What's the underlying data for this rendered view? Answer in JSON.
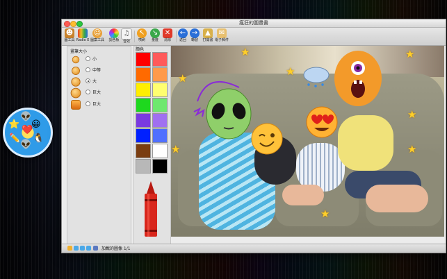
{
  "window": {
    "title": "瘋狂的圖畫書"
  },
  "toolbar": {
    "buttons": [
      {
        "label": "圖工具",
        "icon": "person-tool-icon",
        "color": "#c9822b"
      },
      {
        "label": "Radio E",
        "icon": "crayons-icon",
        "color": "#3a8d3a"
      },
      {
        "label": "圖案工具",
        "icon": "smiley-icon",
        "color": "#e8a13a"
      },
      {
        "label": "調色板",
        "icon": "palette-icon",
        "color": "#8a5ad8"
      },
      {
        "label": "音效",
        "icon": "music-icon",
        "color": "#777777"
      },
      {
        "label": "噴刷",
        "icon": "spray-icon",
        "color": "#f0a020"
      },
      {
        "label": "量度",
        "icon": "check-icon",
        "color": "#3aa84a"
      },
      {
        "label": "清除",
        "icon": "close-icon",
        "color": "#e03a2a"
      },
      {
        "label": "返回",
        "icon": "back-arrow-icon",
        "color": "#2a6fd8"
      },
      {
        "label": "轉發",
        "icon": "forward-arrow-icon",
        "color": "#2a6fd8"
      },
      {
        "label": "打開書",
        "icon": "open-book-icon",
        "color": "#d8b04a"
      },
      {
        "label": "電子郵件",
        "icon": "email-icon",
        "color": "#e8c070"
      }
    ]
  },
  "size_panel": {
    "heading": "畫筆大小",
    "options": [
      {
        "label": "小",
        "selected": false
      },
      {
        "label": "中等",
        "selected": false
      },
      {
        "label": "大",
        "selected": true
      },
      {
        "label": "巨大",
        "selected": false
      },
      {
        "label": "巨大",
        "selected": false
      }
    ]
  },
  "color_panel": {
    "heading": "顏色",
    "swatches": [
      "#ff0000",
      "#ff5a5a",
      "#ff6a00",
      "#ff9a4a",
      "#ffee00",
      "#ffff70",
      "#1ed81e",
      "#6ee86e",
      "#7a3ae0",
      "#a070f0",
      "#0020ff",
      "#5070ff",
      "#7a3d10",
      "#ffffff",
      "#b8b8b8",
      "#000000"
    ],
    "selected_crayon": "#d8261c"
  },
  "status": {
    "text": "加載的圖像 1/1"
  }
}
